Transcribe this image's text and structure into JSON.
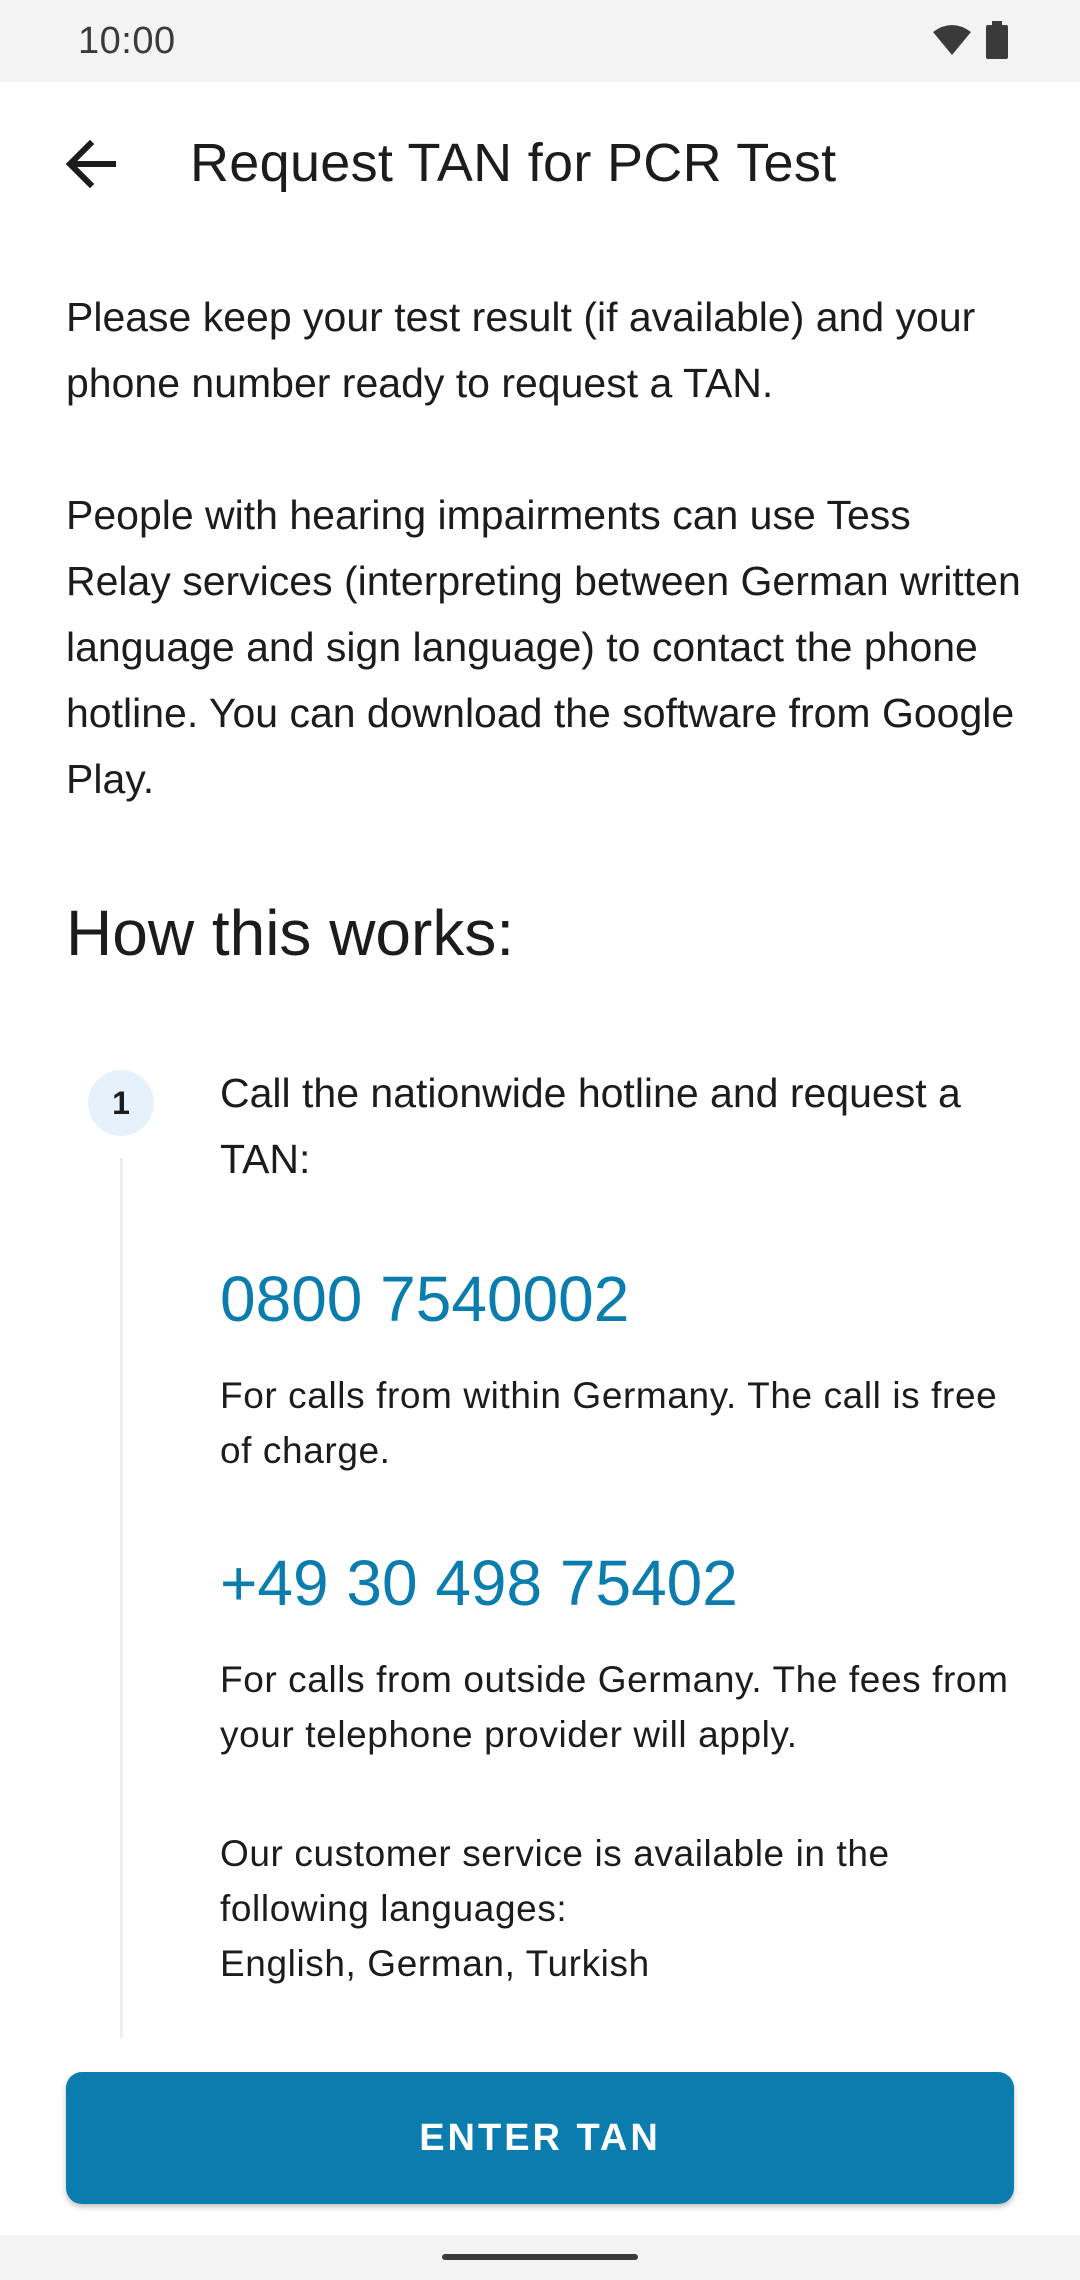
{
  "status_bar": {
    "time": "10:00",
    "icons": [
      "wifi-icon",
      "battery-icon"
    ]
  },
  "app_bar": {
    "back_icon": "arrow-left-icon",
    "title": "Request TAN for PCR Test"
  },
  "intro": {
    "paragraph_1": "Please keep your test result (if available) and your phone number ready to request a TAN.",
    "paragraph_2": "People with hearing impairments can use Tess Relay services (interpreting between German written language and sign language) to contact the phone hotline. You can download the software from Google Play."
  },
  "how_it_works": {
    "title": "How this works:",
    "step_number": "1",
    "step_text": "Call the nationwide hotline and request a TAN:",
    "phone_domestic": "0800 7540002",
    "phone_domestic_note": "For calls from within Germany. The call is free of charge.",
    "phone_international": "+49 30 498 75402",
    "phone_international_note": "For calls from outside Germany. The fees from your telephone provider will apply.",
    "languages_intro": "Our customer service is available in the following languages:",
    "languages_list": "English, German, Turkish"
  },
  "actions": {
    "enter_tan_label": "ENTER TAN"
  },
  "colors": {
    "accent": "#0a7cae",
    "badge_bg": "#e6f2fb",
    "system_bar": "#f3f3f3"
  }
}
